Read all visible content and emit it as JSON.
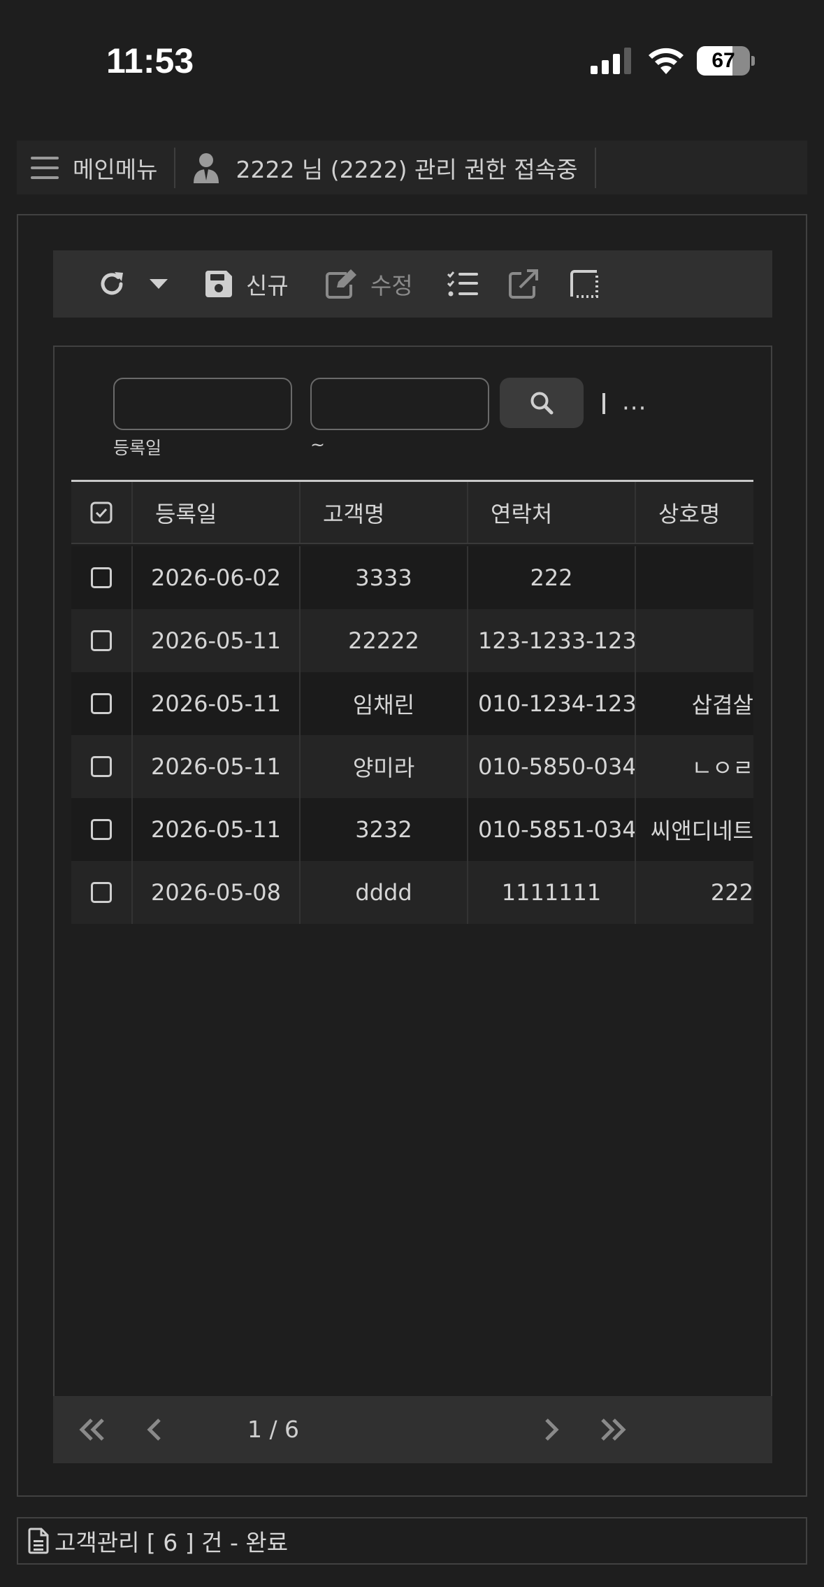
{
  "status_bar": {
    "time": "11:53",
    "battery": "67",
    "battery_level": 0.67
  },
  "nav": {
    "menu_label": "메인메뉴",
    "user_label": "2222 님 (2222) 관리 권한 접속중"
  },
  "toolbar": {
    "new_label": "신규",
    "edit_label": "수정"
  },
  "search": {
    "date_from_value": "",
    "date_to_value": "",
    "date_label": "등록일",
    "range_sep": "~",
    "more": "···"
  },
  "grid": {
    "columns": [
      "등록일",
      "고객명",
      "연락처",
      "상호명"
    ],
    "rows": [
      {
        "date": "2026-06-02",
        "name": "3333",
        "phone": "222",
        "company": ""
      },
      {
        "date": "2026-05-11",
        "name": "22222",
        "phone": "123-1233-123",
        "company": ""
      },
      {
        "date": "2026-05-11",
        "name": "임채린",
        "phone": "010-1234-123",
        "company": "삽겹살"
      },
      {
        "date": "2026-05-11",
        "name": "양미라",
        "phone": "010-5850-034",
        "company": "ㄴㅇㄹ"
      },
      {
        "date": "2026-05-11",
        "name": "3232",
        "phone": "010-5851-034",
        "company": "씨앤디네트"
      },
      {
        "date": "2026-05-08",
        "name": "dddd",
        "phone": "1111111",
        "company": "222"
      }
    ]
  },
  "pager": {
    "page_text": "1 / 6"
  },
  "footer": {
    "status_text": "고객관리 [ 6 ] 건 - 완료"
  },
  "colors": {
    "background": "#1e1e1e",
    "panel": "#303030",
    "text": "#d6d6d6",
    "disabled": "#8a8a8a"
  }
}
